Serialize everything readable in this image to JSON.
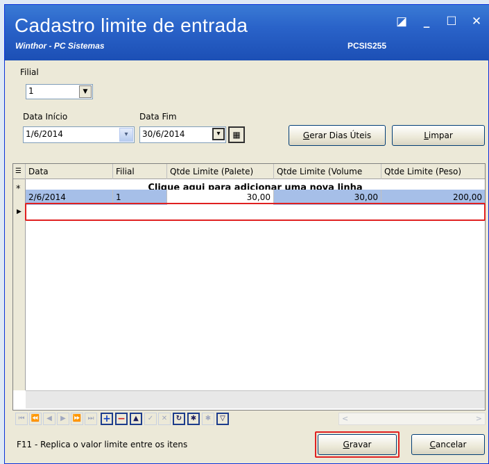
{
  "window": {
    "title": "Cadastro limite de entrada",
    "subtitle": "Winthor - PC Sistemas",
    "code": "PCSIS255",
    "controls": {
      "restore": "◪",
      "minimize": "_",
      "maximize": "☐",
      "close": "✕"
    }
  },
  "form": {
    "filial_label": "Filial",
    "filial_value": "1",
    "data_inicio_label": "Data Início",
    "data_inicio_value": "1/6/2014",
    "data_fim_label": "Data Fim",
    "data_fim_value": "30/6/2014",
    "gerar_first": "G",
    "gerar_rest": "erar Dias Úteis",
    "limpar_first": "L",
    "limpar_rest": "impar"
  },
  "grid": {
    "columns": [
      "Data",
      "Filial",
      "Qtde Limite (Palete)",
      "Qtde Limite (Volume",
      "Qtde Limite (Peso)"
    ],
    "new_row_marker": "*",
    "new_row_text": "Clique aqui para adicionar uma nova linha",
    "current_row_marker": "▶",
    "rows": [
      {
        "data": "2/6/2014",
        "filial": "1",
        "palete": "30,00",
        "volume": "30,00",
        "peso": "200,00"
      }
    ]
  },
  "navigator": {
    "buttons": [
      "⏮",
      "⏪",
      "◀",
      "▶",
      "⏩",
      "⏭",
      "+",
      "−",
      "▲",
      "✓",
      "✕",
      "↻",
      "✱",
      "✱",
      "▽"
    ],
    "scroll_left": "<",
    "scroll_right": ">"
  },
  "footer": {
    "status_text": "F11 - Replica o valor limite entre os itens",
    "gravar_first": "G",
    "gravar_rest": "ravar",
    "cancelar_first": "C",
    "cancelar_rest": "ancelar"
  },
  "colors": {
    "titlebar": "#2a63c9",
    "selected_cell": "#a6bfe8",
    "highlight": "#e02020"
  }
}
